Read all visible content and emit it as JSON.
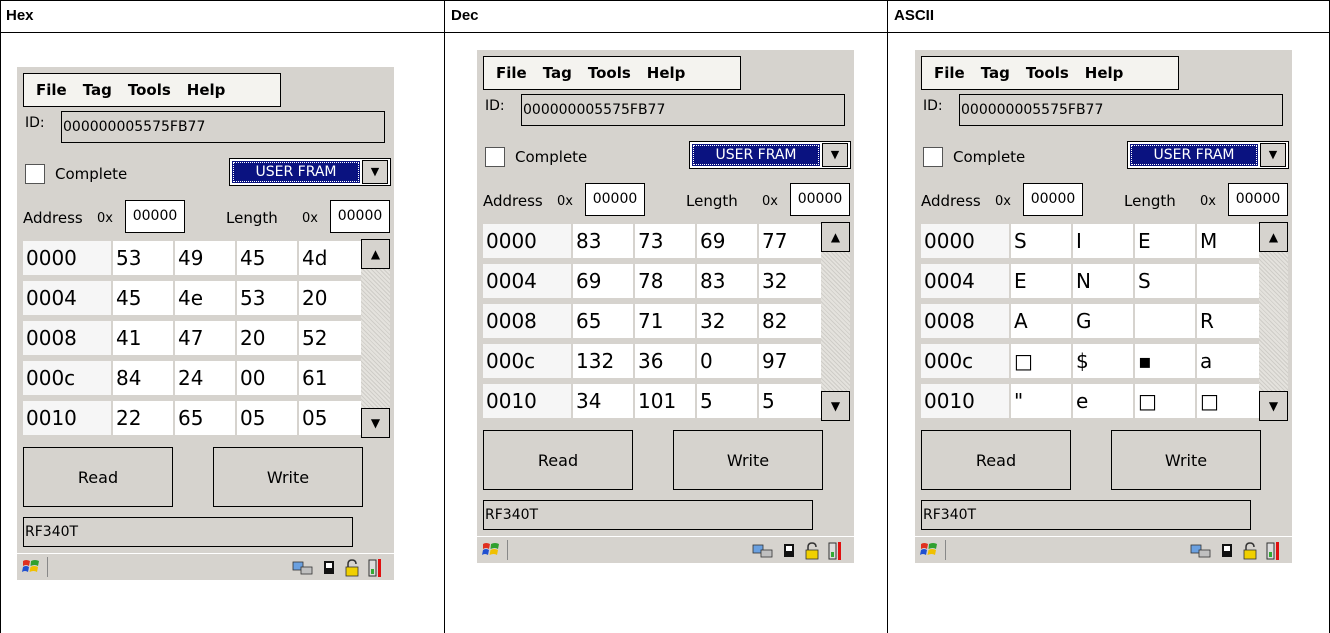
{
  "columns": [
    {
      "header": "Hex",
      "menu": [
        "File",
        "Tag",
        "Tools",
        "Help"
      ],
      "id_label": "ID:",
      "id_value": "000000005575FB77",
      "complete_label": "Complete",
      "memory_select": "USER FRAM",
      "address_label": "Address",
      "hex_prefix": "0x",
      "address_value": "00000",
      "length_label": "Length",
      "length_value": "00000",
      "rows": [
        {
          "addr": "0000",
          "cells": [
            "53",
            "49",
            "45",
            "4d"
          ]
        },
        {
          "addr": "0004",
          "cells": [
            "45",
            "4e",
            "53",
            "20"
          ]
        },
        {
          "addr": "0008",
          "cells": [
            "41",
            "47",
            "20",
            "52"
          ]
        },
        {
          "addr": "000c",
          "cells": [
            "84",
            "24",
            "00",
            "61"
          ]
        },
        {
          "addr": "0010",
          "cells": [
            "22",
            "65",
            "05",
            "05"
          ]
        }
      ],
      "read_label": "Read",
      "write_label": "Write",
      "status_text": "RF340T"
    },
    {
      "header": "Dec",
      "menu": [
        "File",
        "Tag",
        "Tools",
        "Help"
      ],
      "id_label": "ID:",
      "id_value": "000000005575FB77",
      "complete_label": "Complete",
      "memory_select": "USER FRAM",
      "address_label": "Address",
      "hex_prefix": "0x",
      "address_value": "00000",
      "length_label": "Length",
      "length_value": "00000",
      "rows": [
        {
          "addr": "0000",
          "cells": [
            "83",
            "73",
            "69",
            "77"
          ]
        },
        {
          "addr": "0004",
          "cells": [
            "69",
            "78",
            "83",
            "32"
          ]
        },
        {
          "addr": "0008",
          "cells": [
            "65",
            "71",
            "32",
            "82"
          ]
        },
        {
          "addr": "000c",
          "cells": [
            "132",
            "36",
            "0",
            "97"
          ]
        },
        {
          "addr": "0010",
          "cells": [
            "34",
            "101",
            "5",
            "5"
          ]
        }
      ],
      "read_label": "Read",
      "write_label": "Write",
      "status_text": "RF340T"
    },
    {
      "header": "ASCII",
      "menu": [
        "File",
        "Tag",
        "Tools",
        "Help"
      ],
      "id_label": "ID:",
      "id_value": "000000005575FB77",
      "complete_label": "Complete",
      "memory_select": "USER FRAM",
      "address_label": "Address",
      "hex_prefix": "0x",
      "address_value": "00000",
      "length_label": "Length",
      "length_value": "00000",
      "rows": [
        {
          "addr": "0000",
          "cells": [
            "S",
            "I",
            "E",
            "M"
          ]
        },
        {
          "addr": "0004",
          "cells": [
            "E",
            "N",
            "S",
            ""
          ]
        },
        {
          "addr": "0008",
          "cells": [
            "A",
            "G",
            "",
            "R"
          ]
        },
        {
          "addr": "000c",
          "cells": [
            "□",
            "$",
            "▪",
            "a"
          ]
        },
        {
          "addr": "0010",
          "cells": [
            "\"",
            "e",
            "□",
            "□"
          ]
        }
      ],
      "read_label": "Read",
      "write_label": "Write",
      "status_text": "RF340T"
    }
  ],
  "icons": {
    "start": "windows-flag-icon",
    "tray": [
      "network-icon",
      "card-icon",
      "lock-icon",
      "battery-icon"
    ],
    "scroll_up": "scroll-up-arrow-icon",
    "scroll_down": "scroll-down-arrow-icon",
    "dropdown": "dropdown-arrow-icon"
  },
  "colors": {
    "panel_bg": "#d6d3ce",
    "selection_bg": "#0a1280",
    "battery_red": "#e01010"
  }
}
